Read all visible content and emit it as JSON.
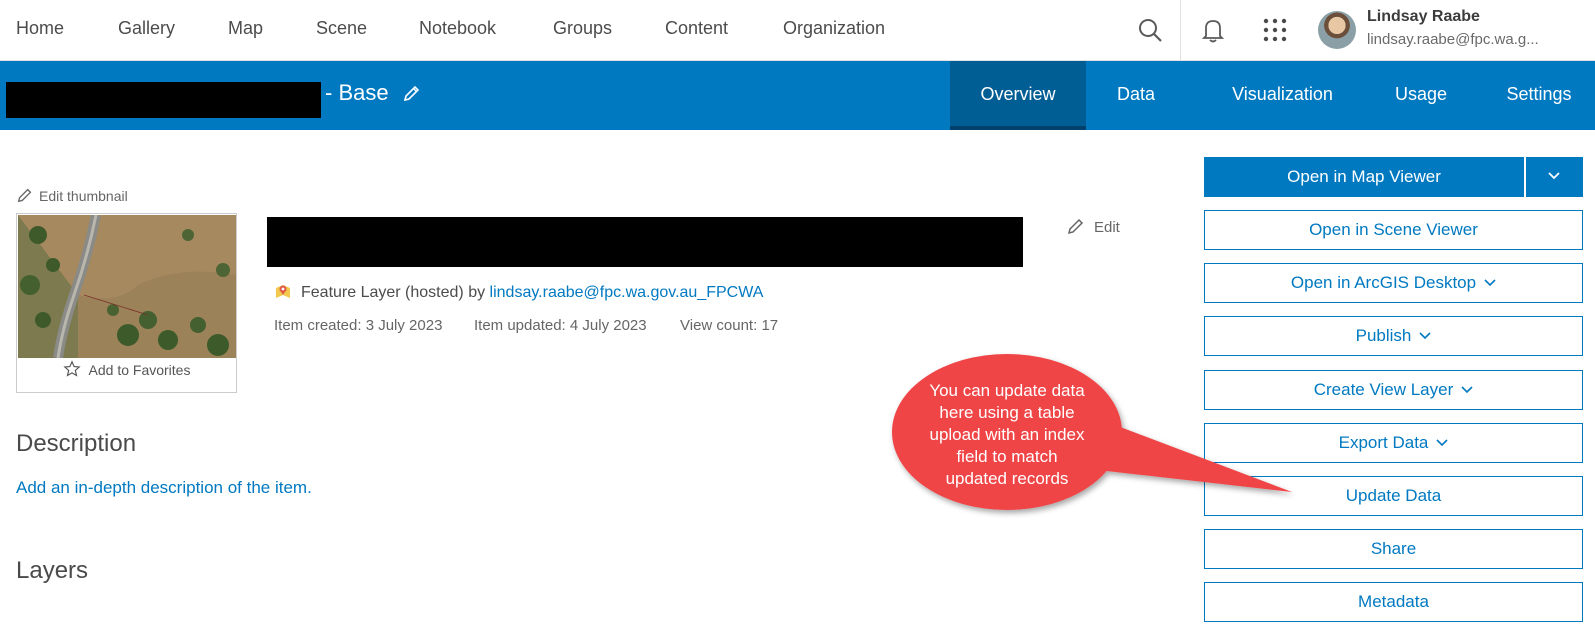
{
  "topnav": {
    "items": [
      {
        "label": "Home"
      },
      {
        "label": "Gallery"
      },
      {
        "label": "Map"
      },
      {
        "label": "Scene"
      },
      {
        "label": "Notebook"
      },
      {
        "label": "Groups"
      },
      {
        "label": "Content"
      },
      {
        "label": "Organization"
      }
    ],
    "icons": [
      "search-icon",
      "bell-icon",
      "app-launcher-icon"
    ],
    "user": {
      "name": "Lindsay Raabe",
      "email": "lindsay.raabe@fpc.wa.g..."
    }
  },
  "item_header": {
    "title_suffix": "- Base",
    "tabs": [
      {
        "label": "Overview",
        "active": true
      },
      {
        "label": "Data",
        "active": false
      },
      {
        "label": "Visualization",
        "active": false
      },
      {
        "label": "Usage",
        "active": false
      },
      {
        "label": "Settings",
        "active": false
      }
    ]
  },
  "thumbnail": {
    "edit_label": "Edit thumbnail",
    "favorite_label": "Add to Favorites"
  },
  "details": {
    "edit_label": "Edit",
    "type_text": "Feature Layer (hosted) by ",
    "owner": "lindsay.raabe@fpc.wa.gov.au_FPCWA",
    "created": "Item created: 3 July 2023",
    "updated": "Item updated: 4 July 2023",
    "views": "View count: 17"
  },
  "description": {
    "heading": "Description",
    "placeholder_link": "Add an in-depth description of the item."
  },
  "layers": {
    "heading": "Layers"
  },
  "actions": {
    "primary": "Open in Map Viewer",
    "buttons": [
      {
        "label": "Open in Scene Viewer",
        "dropdown": false
      },
      {
        "label": "Open in ArcGIS Desktop",
        "dropdown": true
      },
      {
        "label": "Publish",
        "dropdown": true
      },
      {
        "label": "Create View Layer",
        "dropdown": true
      },
      {
        "label": "Export Data",
        "dropdown": true
      },
      {
        "label": "Update Data",
        "dropdown": false
      },
      {
        "label": "Share",
        "dropdown": false
      },
      {
        "label": "Metadata",
        "dropdown": false
      }
    ]
  },
  "callout": {
    "text_lines": [
      "You can update data",
      "here using a table",
      "upload with an index",
      "field to match",
      "updated records"
    ],
    "color": "#f04546"
  },
  "colors": {
    "brand_blue": "#0079c1",
    "active_tab": "#005e95"
  }
}
